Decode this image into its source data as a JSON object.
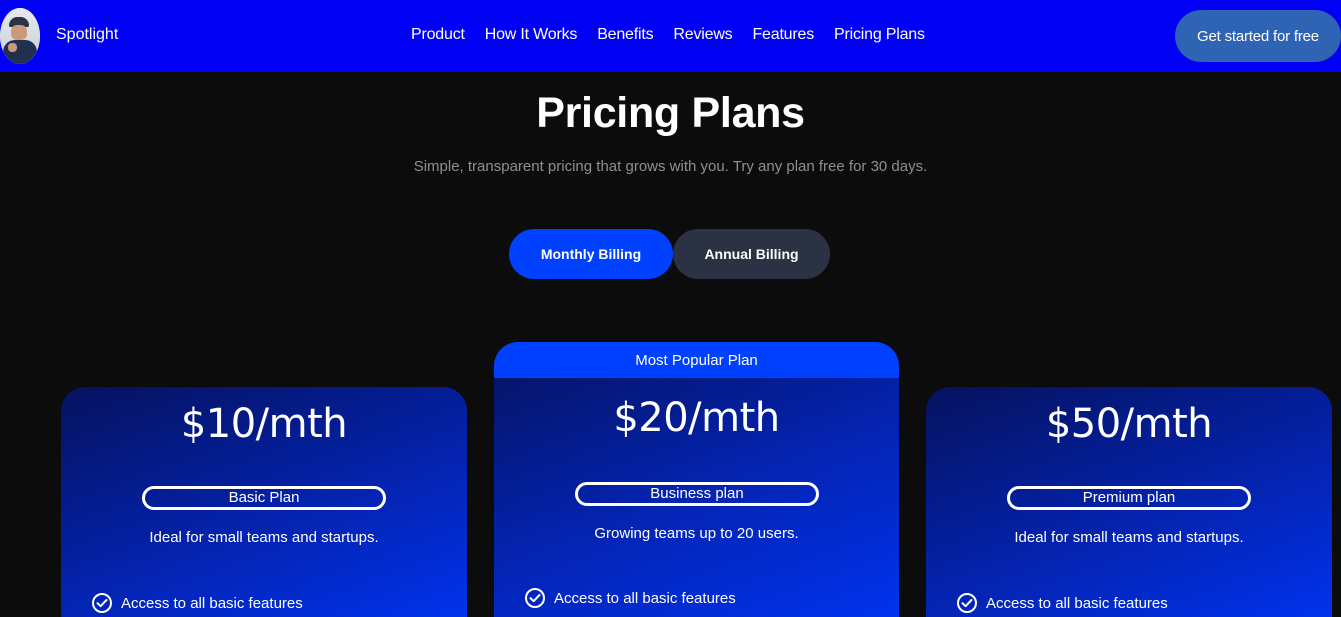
{
  "header": {
    "brand": "Spotlight",
    "nav": [
      "Product",
      "How It Works",
      "Benefits",
      "Reviews",
      "Features",
      "Pricing Plans"
    ],
    "cta_label": "Get started for free"
  },
  "hero": {
    "title": "Pricing Plans",
    "subtitle": "Simple, transparent pricing that grows with you. Try any plan free for 30 days."
  },
  "billing": {
    "monthly_label": "Monthly Billing",
    "annual_label": "Annual Billing",
    "selected": "Monthly Billing"
  },
  "plans": [
    {
      "price": "$10/mth",
      "name": "Basic Plan",
      "description": "Ideal for small teams and startups.",
      "features": [
        "Access to all basic features"
      ]
    },
    {
      "badge": "Most Popular Plan",
      "price": "$20/mth",
      "name": "Business plan",
      "description": "Growing teams up to 20 users.",
      "features": [
        "Access to all basic features"
      ]
    },
    {
      "price": "$50/mth",
      "name": "Premium plan",
      "description": "Ideal for small teams and startups.",
      "features": [
        "Access to all basic features"
      ]
    }
  ],
  "icons": {
    "feature_check": "check-circle-icon",
    "avatar": "user-avatar-photo"
  },
  "colors": {
    "nav_bg": "#0000f5",
    "accent": "#0040ff",
    "cta_bg": "#2f63b3",
    "annual_bg": "#2b3243",
    "page_bg": "#0c0c0c"
  }
}
